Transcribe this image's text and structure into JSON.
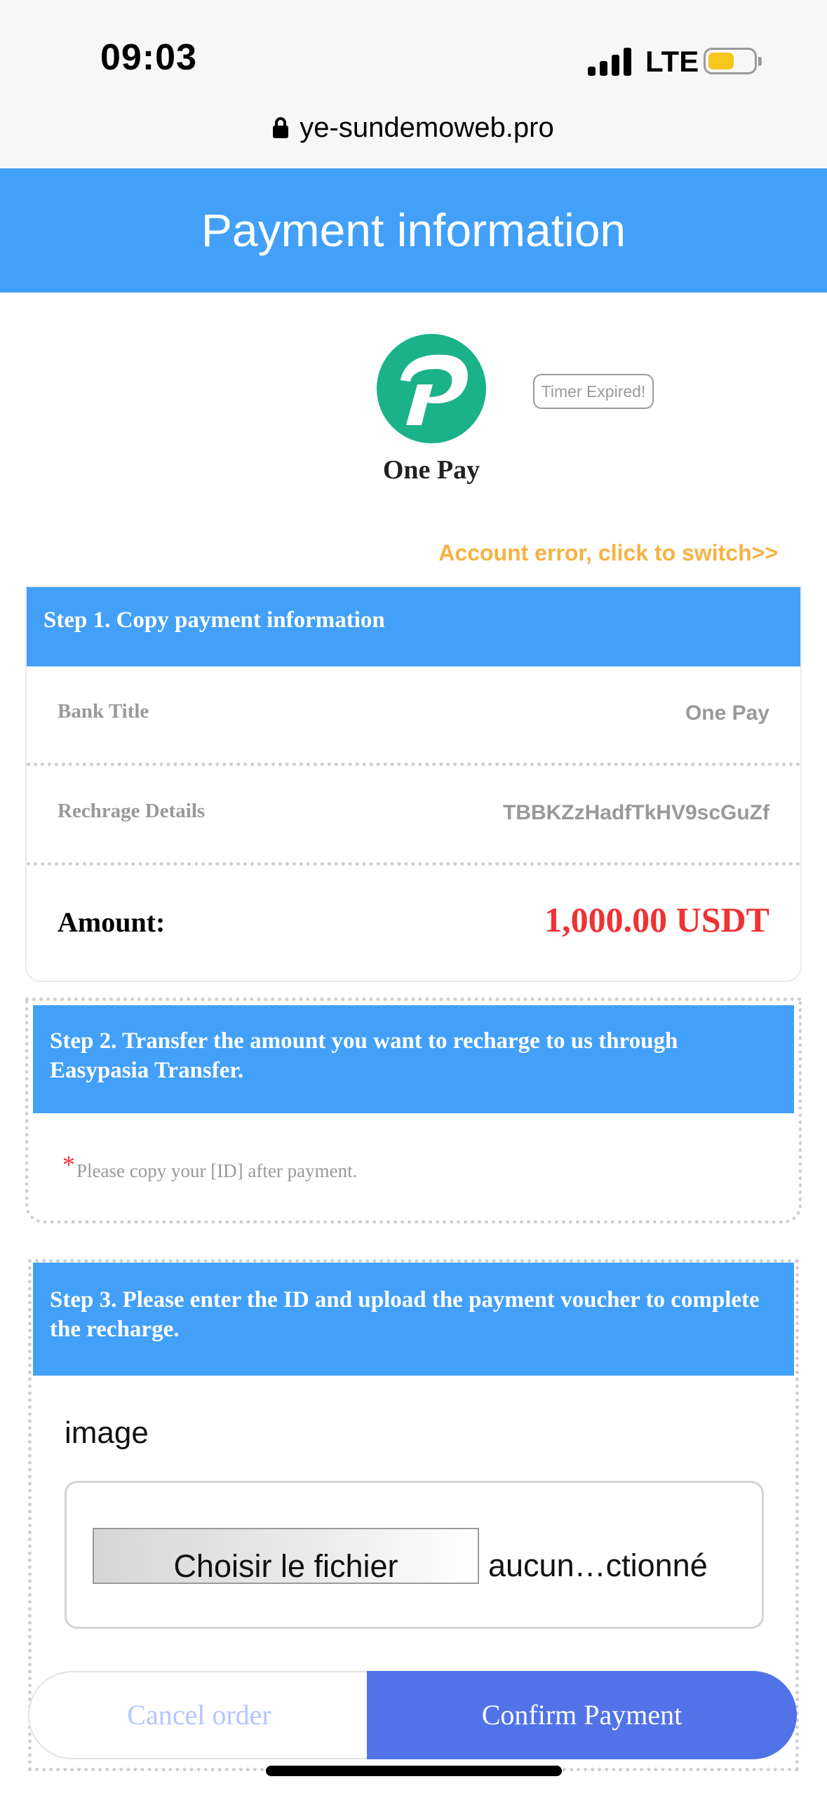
{
  "status_bar": {
    "time": "09:03",
    "network": "LTE",
    "battery_level": 0.5,
    "battery_color": "#f6c71c"
  },
  "browser": {
    "url": "ye-sundemoweb.pro",
    "lock_icon": "lock-icon"
  },
  "header": {
    "title": "Payment information",
    "color": "#42a0f8"
  },
  "merchant": {
    "logo_icon": "one-pay-logo",
    "name": "One Pay",
    "timer_text": "Timer Expired!",
    "logo_color": "#1bb28a"
  },
  "switch_link": "Account error, click to switch>>",
  "step1": {
    "title": "Step 1. Copy payment information",
    "rows": [
      {
        "label": "Bank Title",
        "value": "One Pay"
      },
      {
        "label": "Rechrage Details",
        "value": "TBBKZzHadfTkHV9scGuZf"
      }
    ],
    "amount_label": "Amount:",
    "amount_value": "1,000.00 USDT",
    "amount_color": "#ef3233"
  },
  "step2": {
    "title": "Step 2. Transfer the amount you want to recharge to us through Easypasia Transfer.",
    "required_mark": "*",
    "note": "Please copy your [ID] after payment."
  },
  "step3": {
    "title": "Step 3. Please enter the ID and upload the payment voucher to complete the recharge.",
    "image_label": "image",
    "file_button": "Choisir le fichier",
    "file_status": "aucun…ctionné"
  },
  "actions": {
    "cancel": "Cancel order",
    "confirm": "Confirm Payment",
    "confirm_color": "#5273e8"
  }
}
